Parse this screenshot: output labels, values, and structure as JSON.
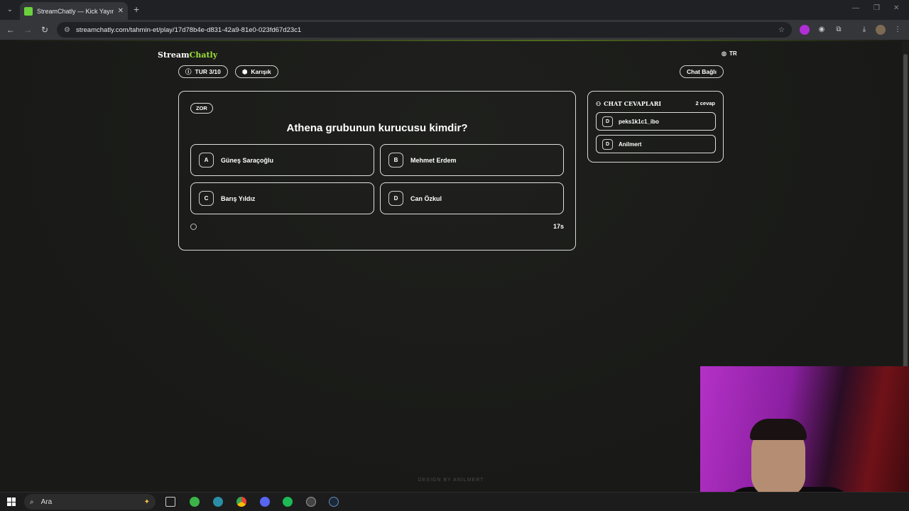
{
  "browser": {
    "tab_title": "StreamChatly — Kick Yayıncılar",
    "url": "streamchatly.com/tahmin-et/play/17d78b4e-d831-42a9-81e0-023fd67d23c1"
  },
  "header": {
    "logo_part1": "Stream",
    "logo_part2": "Chatly",
    "language": "TR"
  },
  "status": {
    "round": "TUR 3/10",
    "category": "Karışık",
    "chat_status": "Chat Bağlı"
  },
  "question": {
    "difficulty": "ZOR",
    "text": "Athena grubunun kurucusu kimdir?",
    "options": [
      {
        "letter": "A",
        "text": "Güneş Saraçoğlu"
      },
      {
        "letter": "B",
        "text": "Mehmet Erdem"
      },
      {
        "letter": "C",
        "text": "Barış Yıldız"
      },
      {
        "letter": "D",
        "text": "Can Özkul"
      }
    ],
    "timer": "17s"
  },
  "chat": {
    "title": "CHAT CEVAPLARI",
    "count": "2 cevap",
    "answers": [
      {
        "letter": "D",
        "user": "peks1k1c1_ibo"
      },
      {
        "letter": "D",
        "user": "Anilmert"
      }
    ]
  },
  "footer": {
    "text": "DESIGN BY ANİLMERT"
  },
  "taskbar": {
    "search_placeholder": "Ara"
  },
  "colors": {
    "accent": "#9be03a",
    "background": "#1a1b18"
  }
}
